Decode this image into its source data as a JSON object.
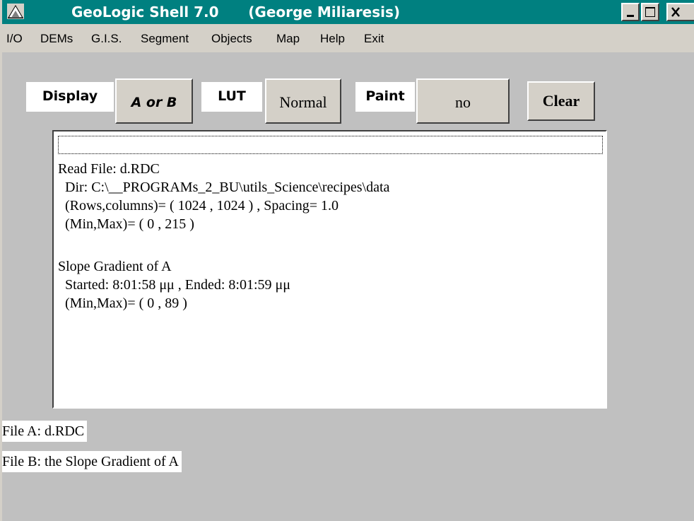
{
  "window": {
    "title": "GeoLogic Shell 7.0      (George Miliaresis)",
    "app_icon": "mountain-icon",
    "controls": [
      "minimize-icon",
      "maximize-icon",
      "close-icon"
    ]
  },
  "menu": {
    "items": [
      "I/O",
      "DEMs",
      "G.I.S.",
      "Segment",
      "Objects",
      "Map",
      "Help",
      "Exit"
    ]
  },
  "toolbar": {
    "display_label": "Display",
    "display_value": "A or B",
    "lut_label": "LUT",
    "lut_value": "Normal",
    "paint_label": "Paint",
    "paint_value": "no",
    "clear_label": "Clear"
  },
  "log": {
    "input_value": "",
    "lines": [
      "Read File: d.RDC",
      "  Dir: C:\\__PROGRAMs_2_BU\\utils_Science\\recipes\\data",
      "  (Rows,columns)= ( 1024 , 1024 ) , Spacing= 1.0",
      "  (Min,Max)= ( 0 , 215 )",
      "",
      "Slope Gradient of A",
      "  Started: 8:01:58 μμ , Ended: 8:01:59 μμ",
      "  (Min,Max)= ( 0 , 89 )"
    ]
  },
  "status": {
    "file_a": "File A: d.RDC",
    "file_b": "File B: the Slope Gradient of A"
  },
  "colors": {
    "titlebar": "#008080",
    "face": "#d4d0c8",
    "background": "#c0c0c0"
  }
}
